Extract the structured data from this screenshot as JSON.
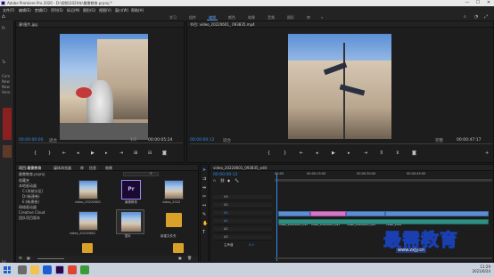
{
  "window": {
    "title": "Adobe Premiere Pro 2020 - D:\\视频\\2020年\\最需教育.prproj *",
    "minimize": "—",
    "maximize": "☐",
    "close": "✕"
  },
  "menu": [
    "文件(F)",
    "编辑(E)",
    "剪辑(C)",
    "序列(S)",
    "标记(M)",
    "图形(G)",
    "视图(V)",
    "窗口(W)",
    "帮助(H)"
  ],
  "workspaces": [
    "学习",
    "组件",
    "编辑",
    "颜色",
    "效果",
    "音频",
    "图形",
    "库",
    "»"
  ],
  "left_strip": {
    "labels": [
      "Pr",
      "Tu",
      "Com",
      "New",
      "New",
      "Here",
      "Lo"
    ]
  },
  "source": {
    "tab": "源:图片.jpg",
    "timecode_in": "00:00:00:00",
    "fit": "适合",
    "scale": "1/2",
    "timecode_out": "00:00:05:24"
  },
  "program": {
    "tab": "节目: video_20220601_ 093835.mp4",
    "timecode_in": "00:00:00:12",
    "fit": "适合",
    "quality": "完整",
    "timecode_out": "00:00:47:17"
  },
  "project": {
    "tabs": [
      "项目:最需教育",
      "媒体浏览器",
      "库",
      "信息",
      "效果"
    ],
    "path": "最需教育.prproj",
    "tree": [
      "收藏夹",
      "本地驱动器",
      "C:(系统分区)",
      "D:(新建卷)",
      "E:(新建卷)",
      "网络驱动器",
      "Creative Cloud",
      "团队项目版本"
    ],
    "items": [
      {
        "label": "video_20220601",
        "kind": "video"
      },
      {
        "label": "最需教育",
        "kind": "prproj"
      },
      {
        "label": "video_2022",
        "kind": "video"
      },
      {
        "label": "video_20220601",
        "kind": "video"
      },
      {
        "label": "图片",
        "kind": "image"
      },
      {
        "label": "新建文件夹",
        "kind": "folder"
      }
    ]
  },
  "timeline": {
    "tab": "video_20220601_093835_edit",
    "timecode": "00:00:00:12",
    "ruler": [
      "00:00",
      "00:00:15:00",
      "00:00:30:00",
      "00:00:45:00"
    ],
    "tracks": [
      "V3",
      "V2",
      "V1",
      "A1",
      "A2",
      "A3",
      "主声道"
    ],
    "master_value": "0.0",
    "clips": [
      {
        "name": "video_20220601_093",
        "type": "v"
      },
      {
        "name": "video_20220601_093",
        "type": "p"
      },
      {
        "name": "video_20220601_093",
        "type": "v"
      },
      {
        "name": "video_2022",
        "type": "v"
      }
    ]
  },
  "tools": [
    "selection-tool-icon",
    "track-select-icon",
    "ripple-edit-icon",
    "razor-icon",
    "slip-icon",
    "pen-icon",
    "hand-icon",
    "type-icon"
  ],
  "taskbar": {
    "time": "11:29",
    "date": "2021/6/24"
  },
  "watermark": {
    "text": "最需教育",
    "url": "www.zxjy.cn"
  }
}
